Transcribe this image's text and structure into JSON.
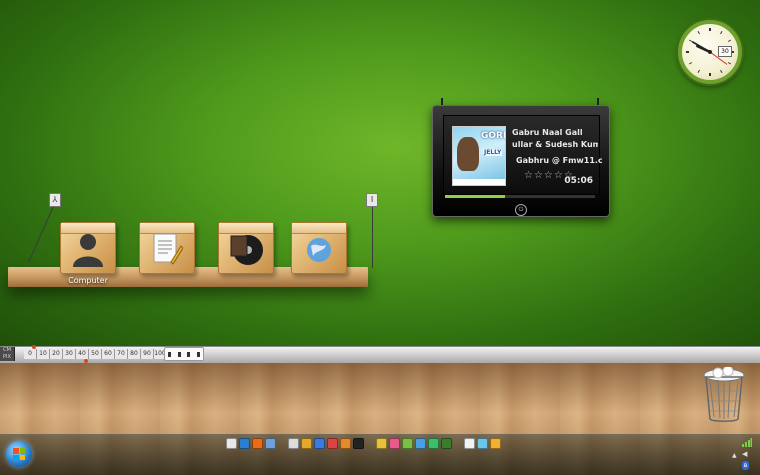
{
  "shelf": {
    "items": [
      {
        "name": "Computer",
        "icon": "user-silhouette-icon"
      },
      {
        "name": "",
        "icon": "documents-icon"
      },
      {
        "name": "",
        "icon": "music-disc-icon"
      },
      {
        "name": "",
        "icon": "network-globe-icon"
      }
    ],
    "hook_left_glyph": "⅄",
    "hook_right_glyph": "Ⅰ"
  },
  "player": {
    "cover": {
      "title_text": "GORI",
      "sub_text": "JELLY"
    },
    "track_title": "Gabru Naal Gall",
    "artist": "ullar & Sudesh Kuma",
    "album": "Gabhru @ Fmw11.c",
    "rating_glyphs": "☆☆☆☆☆",
    "time": "05:06",
    "progress": 0.4,
    "power_glyph": "⏻"
  },
  "clock": {
    "date": "30",
    "hour": 9,
    "minute": 50,
    "second": 21
  },
  "ruler": {
    "left_label_top": "CM",
    "left_label_bottom": "PIX",
    "ticks": [
      "0",
      "10",
      "20",
      "30",
      "40",
      "50",
      "60",
      "70",
      "80",
      "90",
      "100"
    ]
  },
  "taskbar": {
    "start_icon": "windows-orb-icon",
    "dock_icons": [
      {
        "name": "mail-icon",
        "color": "#e8e8e8"
      },
      {
        "name": "globe-icon",
        "color": "#2b7fcf"
      },
      {
        "name": "firefox-icon",
        "color": "#e86b1c"
      },
      {
        "name": "app-icon",
        "color": "#6fa0d8"
      },
      {
        "name": "network-icon",
        "color": "#dcdcdc"
      },
      {
        "name": "orb-icon",
        "color": "#e2a92b"
      },
      {
        "name": "folder-icon",
        "color": "#3d7bd8"
      },
      {
        "name": "chrome-icon",
        "color": "#d44"
      },
      {
        "name": "media-icon",
        "color": "#e58a2a"
      },
      {
        "name": "camera-icon",
        "color": "#222"
      },
      {
        "name": "star-icon",
        "color": "#e8c33a"
      },
      {
        "name": "paint-icon",
        "color": "#e85a8f"
      },
      {
        "name": "chat-icon",
        "color": "#7bc043"
      },
      {
        "name": "phone-icon",
        "color": "#4aa0e0"
      },
      {
        "name": "tool-icon",
        "color": "#3dbf6a"
      },
      {
        "name": "grid-icon",
        "color": "#3a7d2a"
      },
      {
        "name": "bubble-icon",
        "color": "#f2f2f2"
      },
      {
        "name": "flower-icon",
        "color": "#6bc5e8"
      },
      {
        "name": "smile-icon",
        "color": "#f0b030"
      }
    ],
    "tray": {
      "bluetooth_glyph": "ʙ",
      "volume_glyph": "◀",
      "expand_glyph": "▲"
    }
  },
  "colors": {
    "wall": "#4e9a1c",
    "floor": "#c89c6a",
    "accent": "#8fd24a"
  }
}
